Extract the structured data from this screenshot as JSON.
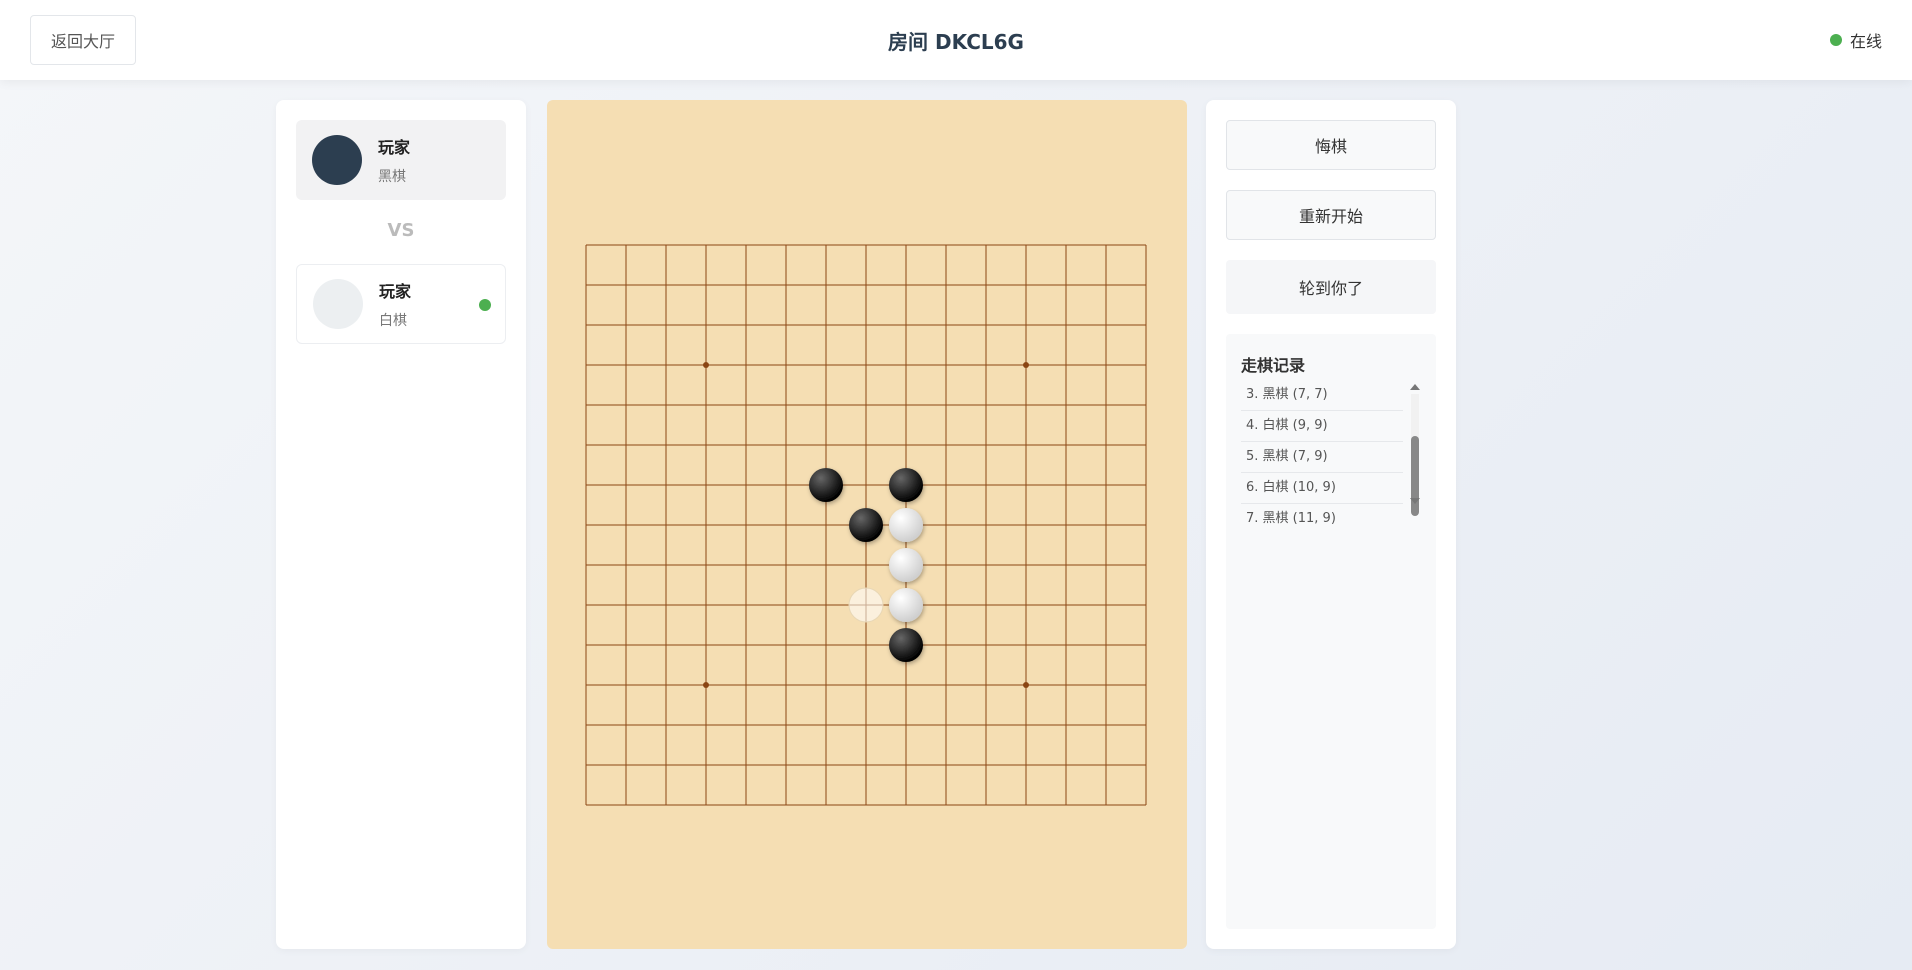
{
  "header": {
    "back_label": "返回大厅",
    "room_title": "房间 DKCL6G",
    "status_label": "在线",
    "status_color": "#4caf50"
  },
  "players": {
    "black": {
      "name": "玩家",
      "color_label": "黑棋",
      "avatar_color": "#2c3e50"
    },
    "vs_label": "VS",
    "white": {
      "name": "玩家",
      "color_label": "白棋",
      "avatar_color": "#eceff1",
      "online_color": "#4caf50"
    }
  },
  "board": {
    "size": 15,
    "background": "#f5deb3",
    "line_color": "#8b4513",
    "star_points": [
      [
        3,
        3
      ],
      [
        3,
        11
      ],
      [
        11,
        3
      ],
      [
        11,
        11
      ]
    ],
    "stones": [
      {
        "color": "black",
        "row": 6,
        "col": 6
      },
      {
        "color": "black",
        "row": 6,
        "col": 8
      },
      {
        "color": "black",
        "row": 7,
        "col": 7
      },
      {
        "color": "white",
        "row": 7,
        "col": 8
      },
      {
        "color": "white",
        "row": 8,
        "col": 8
      },
      {
        "color": "white",
        "row": 9,
        "col": 8
      },
      {
        "color": "black",
        "row": 10,
        "col": 8
      }
    ],
    "hover_stone": {
      "color": "white",
      "row": 9,
      "col": 7
    }
  },
  "controls": {
    "undo_label": "悔棋",
    "restart_label": "重新开始",
    "turn_label": "轮到你了"
  },
  "history": {
    "title": "走棋记录",
    "items": [
      "3. 黑棋 (7, 7)",
      "4. 白棋 (9, 9)",
      "5. 黑棋 (7, 9)",
      "6. 白棋 (10, 9)",
      "7. 黑棋 (11, 9)"
    ]
  }
}
